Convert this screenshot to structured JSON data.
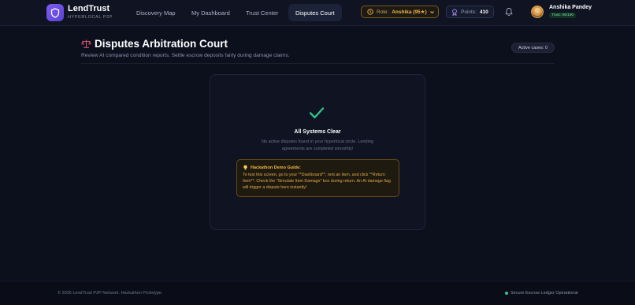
{
  "brand": {
    "name": "LendTrust",
    "tagline": "HYPERLOCAL P2P",
    "icon": "shield-icon",
    "color": "#6d4fe6"
  },
  "nav": {
    "items": [
      {
        "label": "Discovery Map"
      },
      {
        "label": "My Dashboard"
      },
      {
        "label": "Trust Center"
      },
      {
        "label": "Disputes Court",
        "active": true
      }
    ]
  },
  "role": {
    "label": "Role:",
    "value": "Anshika (95★)",
    "icon": "clock-icon"
  },
  "points": {
    "label": "Points:",
    "value": "410",
    "icon": "medal-icon"
  },
  "notifications": {
    "icon": "bell-icon"
  },
  "user": {
    "name": "Anshika Pandey",
    "trust": "Trust: 95/100"
  },
  "page": {
    "icon": "scales-icon",
    "title": "Disputes Arbitration Court",
    "subtitle": "Review AI compared condition reports. Settle escrow deposits fairly during damage claims.",
    "active_cases": "Active cases: 0"
  },
  "empty_state": {
    "icon": "check-icon",
    "title": "All Systems Clear",
    "description": "No active disputes found in your hyperlocal circle. Lending agreements are completed smoothly!"
  },
  "guide": {
    "icon": "lightbulb-icon",
    "title": "Hackathon Demo Guide:",
    "text": "To test this screen, go to your **Dashboard**, rent an item, and click **Return Item**. Check the \"Simulate Item Damage\" box during return. An AI damage flag will trigger a dispute here instantly!"
  },
  "footer": {
    "copyright": "© 2026 LendTrust P2P Network. Hackathon Prototype.",
    "status": "Secure Escrow Ledger Operational",
    "status_color": "#2ec48a"
  }
}
